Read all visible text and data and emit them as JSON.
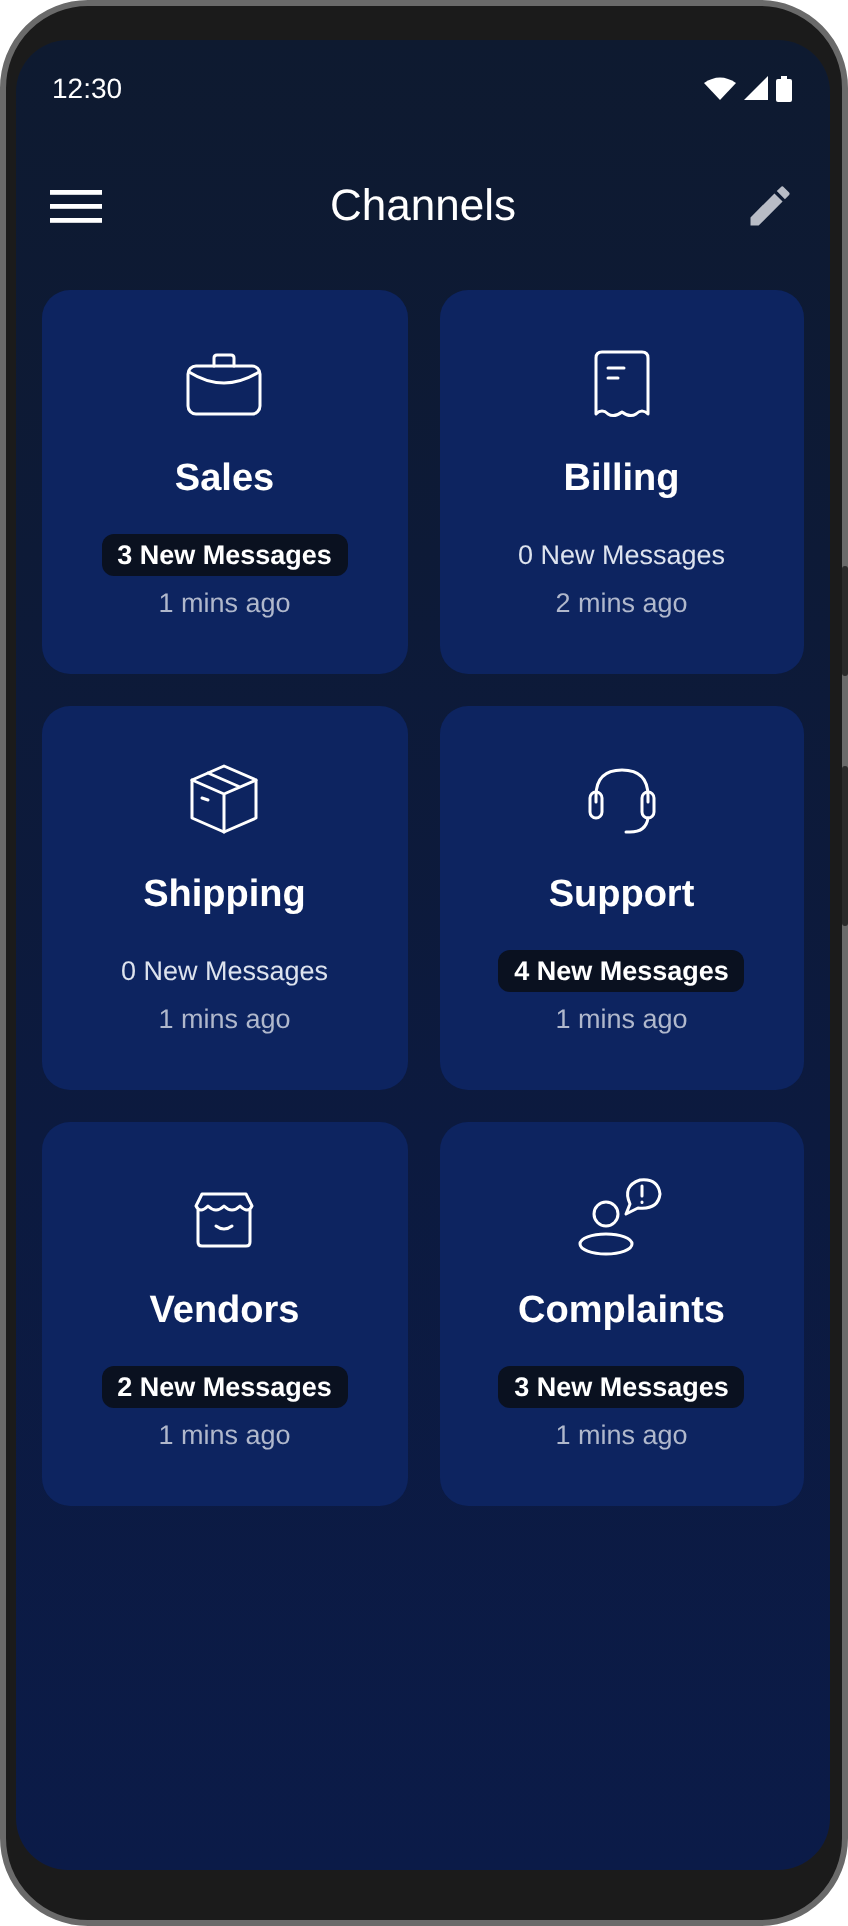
{
  "status_bar": {
    "time": "12:30"
  },
  "header": {
    "title": "Channels"
  },
  "channels": [
    {
      "name": "Sales",
      "messages": "3 New Messages",
      "highlighted": true,
      "time": "1 mins ago"
    },
    {
      "name": "Billing",
      "messages": "0 New Messages",
      "highlighted": false,
      "time": "2 mins ago"
    },
    {
      "name": "Shipping",
      "messages": "0 New Messages",
      "highlighted": false,
      "time": "1 mins ago"
    },
    {
      "name": "Support",
      "messages": "4 New Messages",
      "highlighted": true,
      "time": "1 mins ago"
    },
    {
      "name": "Vendors",
      "messages": "2 New Messages",
      "highlighted": true,
      "time": "1 mins ago"
    },
    {
      "name": "Complaints",
      "messages": "3 New Messages",
      "highlighted": true,
      "time": "1 mins ago"
    }
  ]
}
